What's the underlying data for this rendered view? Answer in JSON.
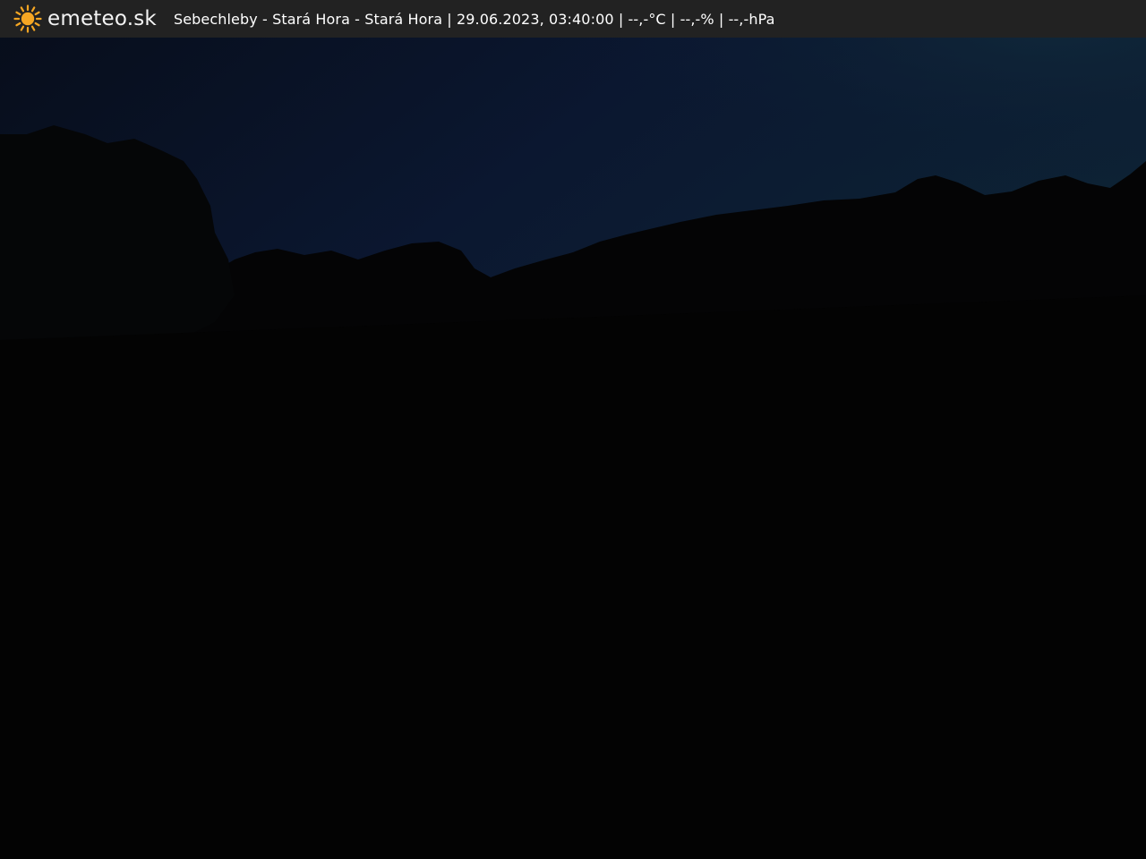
{
  "brand": {
    "name": "emeteo.sk",
    "icon": "sun-icon",
    "icon_color": "#f5a623"
  },
  "caption": {
    "location": "Sebechleby - Stará Hora - Stará Hora",
    "separator": " | ",
    "datetime": "29.06.2023, 03:40:00",
    "temperature": "--,-°C",
    "humidity": "--,-%",
    "pressure": "--,-hPa"
  },
  "scene": {
    "subject": "night webcam view of a dark hillside with tree silhouettes under a deep blue sky",
    "sky_color": "#0a1a2e",
    "ground_color": "#030303"
  }
}
